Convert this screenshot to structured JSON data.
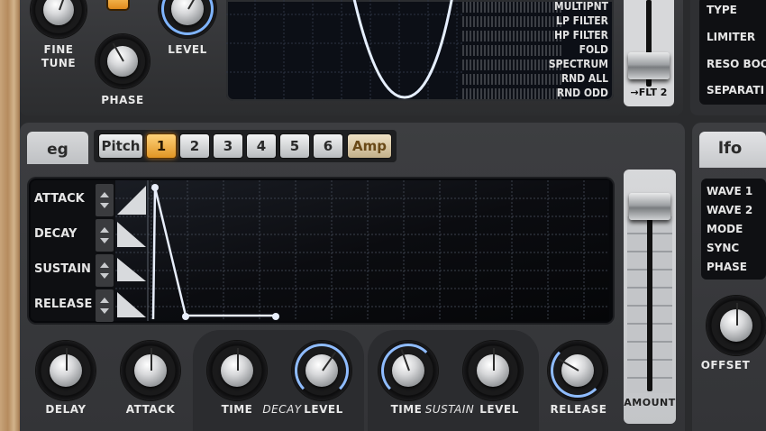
{
  "osc": {
    "fine_tune_label": "FINE\nTUNE",
    "phase_label": "PHASE",
    "level_label": "LEVEL"
  },
  "scope": {
    "modes": [
      "MULTIPNT",
      "LP FILTER",
      "HP FILTER",
      "FOLD",
      "SPECTRUM",
      "RND ALL",
      "RND ODD"
    ]
  },
  "flt_fader": {
    "label": "FLT 2",
    "arrow": "→"
  },
  "filter_params": [
    "TYPE",
    "LIMITER",
    "RESO BOOS",
    "SEPARATI"
  ],
  "eg": {
    "tab_label": "eg",
    "targets": [
      "Pitch",
      "1",
      "2",
      "3",
      "4",
      "5",
      "6",
      "Amp"
    ],
    "active_target": "1",
    "segments": [
      "ATTACK",
      "DECAY",
      "SUSTAIN",
      "RELEASE"
    ],
    "knobs": {
      "delay": "DELAY",
      "attack": "ATTACK",
      "decay_time": "TIME",
      "decay": "DECAY",
      "decay_level": "LEVEL",
      "sustain_time": "TIME",
      "sustain": "SUSTAIN",
      "sustain_level": "LEVEL",
      "release": "RELEASE"
    },
    "amount_label": "AMOUNT"
  },
  "lfo": {
    "tab_label": "lfo",
    "params": [
      "WAVE 1",
      "WAVE 2",
      "MODE",
      "SYNC",
      "PHASE"
    ],
    "offset_label": "OFFSET"
  },
  "colors": {
    "accent_orange": "#e19524",
    "ring_blue": "#7fb4ff",
    "panel": "#3a3b3e"
  }
}
